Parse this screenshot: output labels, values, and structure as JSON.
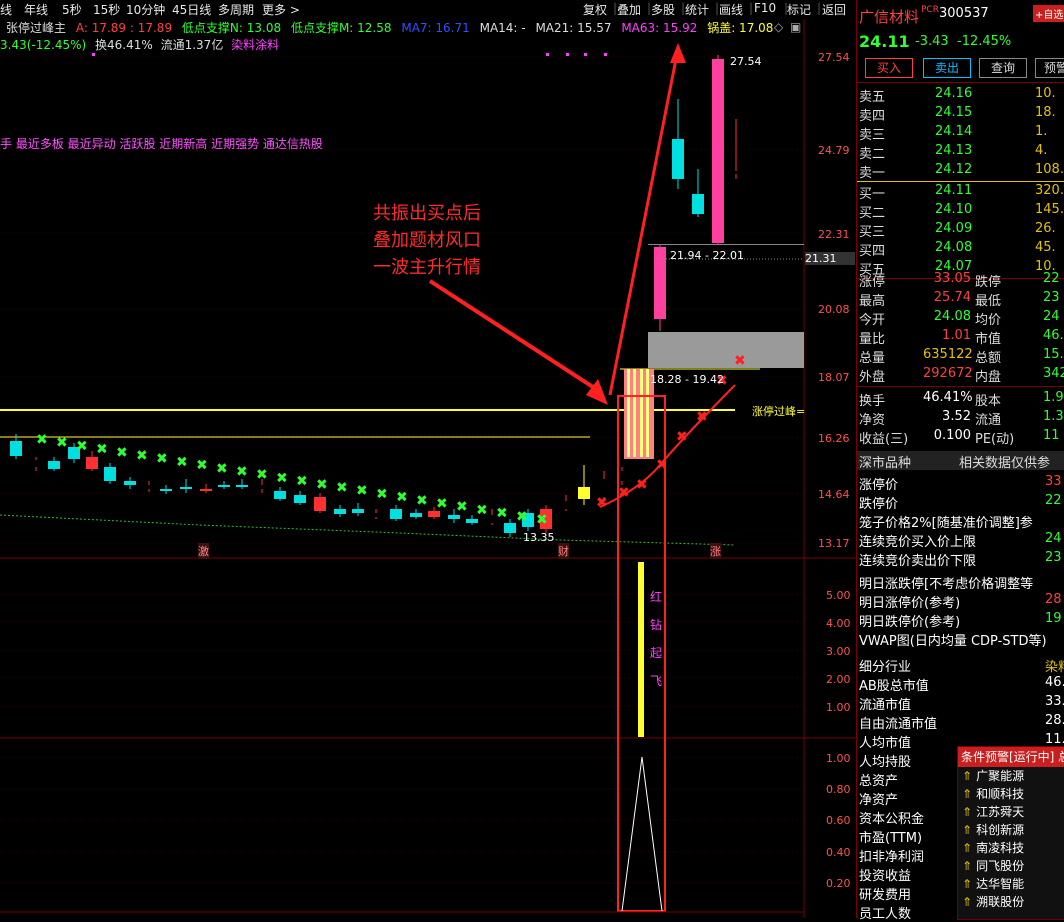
{
  "topbar": {
    "periods": [
      "线",
      "年线",
      "5秒",
      "15秒",
      "10分钟",
      "45日线",
      "多周期",
      "更多 >"
    ],
    "right_buttons": [
      "复权",
      "叠加",
      "多股",
      "统计",
      "画线",
      "F10",
      "标记",
      "返回"
    ]
  },
  "indicator": {
    "name": "张停过峰主",
    "a_label": "A: 17.89 : 17.89",
    "dizhi_n": "低点支撑N: 13.08",
    "dizhi_m": "低点支撑M: 12.58",
    "ma7": "MA7: 16.71",
    "ma14": "MA14: -",
    "ma21": "MA21: 15.57",
    "ma63": "MA63: 15.92",
    "guogai": "锅盖: 17.08",
    "change": "3.43(-12.45%)",
    "turnover": "换46.41%",
    "float": "流通1.37亿",
    "sector": "染料涂料"
  },
  "tags": "手 最近多板 最近异动 活跃股 近期新高 近期强势 通达信热股",
  "annotation": [
    "共振出买点后",
    "叠加题材风口",
    "一波主升行情"
  ],
  "chart_labels": {
    "high_price": "27.54",
    "low_price": "13.35",
    "zone1": "21.94 - 22.01",
    "zone2": "18.28 - 19.42",
    "limit_line": "涨停过峰=",
    "current_price_tag": "21.31",
    "marks": [
      "激",
      "财",
      "涨"
    ],
    "sub_marks": [
      "红",
      "钻",
      "起",
      "飞"
    ]
  },
  "price_axis": [
    "27.54",
    "24.79",
    "22.31",
    "20.08",
    "18.07",
    "16.26",
    "14.64",
    "13.17"
  ],
  "sub_axis1": [
    "5.00",
    "4.00",
    "3.00",
    "2.00",
    "1.00"
  ],
  "sub_axis2": [
    "1.00",
    "0.80",
    "0.60",
    "0.40",
    "0.20"
  ],
  "stock": {
    "name": "广信材料",
    "pcr": "PCR",
    "code": "300537",
    "add_btn": "+自选",
    "price": "24.11",
    "change": "-3.43",
    "pct": "-12.45%",
    "buttons": [
      "买入",
      "卖出",
      "查询",
      "预警"
    ]
  },
  "order_book": {
    "sell": [
      {
        "label": "卖五",
        "price": "24.16",
        "vol": "10."
      },
      {
        "label": "卖四",
        "price": "24.15",
        "vol": "18."
      },
      {
        "label": "卖三",
        "price": "24.14",
        "vol": "1."
      },
      {
        "label": "卖二",
        "price": "24.13",
        "vol": "4."
      },
      {
        "label": "卖一",
        "price": "24.12",
        "vol": "108."
      }
    ],
    "buy": [
      {
        "label": "买一",
        "price": "24.11",
        "vol": "320."
      },
      {
        "label": "买二",
        "price": "24.10",
        "vol": "145."
      },
      {
        "label": "买三",
        "price": "24.09",
        "vol": "26."
      },
      {
        "label": "买四",
        "price": "24.08",
        "vol": "45."
      },
      {
        "label": "买五",
        "price": "24.07",
        "vol": "10."
      }
    ]
  },
  "stats": [
    {
      "l1": "涨停",
      "v1": "33.05",
      "l2": "跌停",
      "v2": "22"
    },
    {
      "l1": "最高",
      "v1": "25.74",
      "l2": "最低",
      "v2": "23"
    },
    {
      "l1": "今开",
      "v1": "24.08",
      "l2": "均价",
      "v2": "24"
    },
    {
      "l1": "量比",
      "v1": "1.01",
      "l2": "市值",
      "v2": "46."
    },
    {
      "l1": "总量",
      "v1": "635122",
      "l2": "总额",
      "v2": "15."
    },
    {
      "l1": "外盘",
      "v1": "292672",
      "l2": "内盘",
      "v2": "342"
    }
  ],
  "stats2": [
    {
      "l1": "换手",
      "v1": "46.41%",
      "l2": "股本",
      "v2": "1.9"
    },
    {
      "l1": "净资",
      "v1": "3.52",
      "l2": "流通",
      "v2": "1.3"
    },
    {
      "l1": "收益(三)",
      "v1": "0.100",
      "l2": "PE(动)",
      "v2": "11"
    }
  ],
  "market": {
    "label": "深市品种",
    "link": "相关数据仅供参"
  },
  "limits": [
    {
      "l": "涨停价",
      "v": "33"
    },
    {
      "l": "跌停价",
      "v": "22"
    },
    {
      "l": "笼子价格2%[随基准价调整]参",
      "v": ""
    },
    {
      "l": "连续竞价买入价上限",
      "v": "24"
    },
    {
      "l": "连续竞价卖出价下限",
      "v": "23"
    }
  ],
  "tomorrow": [
    {
      "l": "明日涨跌停[不考虑价格调整等",
      "v": ""
    },
    {
      "l": "明日涨停价(参考)",
      "v": "28"
    },
    {
      "l": "明日跌停价(参考)",
      "v": "19"
    }
  ],
  "vwap": "VWAP图(日内均量 CDP-STD等)",
  "fundamentals": [
    {
      "l": "细分行业",
      "v": "染料涂"
    },
    {
      "l": "AB股总市值",
      "v": "46.5"
    },
    {
      "l": "流通市值",
      "v": "33.0"
    },
    {
      "l": "自由流通市值",
      "v": "28.0"
    },
    {
      "l": "人均市值",
      "v": "11.6"
    },
    {
      "l": "人均持股",
      "v": ""
    },
    {
      "l": "总资产",
      "v": ""
    },
    {
      "l": "净资产",
      "v": ""
    },
    {
      "l": "资本公积金",
      "v": ""
    },
    {
      "l": "市盈(TTM)",
      "v": ""
    },
    {
      "l": "扣非净利润",
      "v": ""
    },
    {
      "l": "投资收益",
      "v": ""
    },
    {
      "l": "研发费用",
      "v": ""
    },
    {
      "l": "员工人数",
      "v": ""
    }
  ],
  "popup": {
    "title": "条件预警[运行中] 总",
    "items": [
      "广聚能源",
      "和顺科技",
      "江苏舜天",
      "科创新源",
      "南凌科技",
      "同飞股份",
      "达华智能",
      "溯联股份"
    ]
  },
  "colors": {
    "up": "#ff3030",
    "down": "#00d0d0",
    "yellow": "#ffff30",
    "magenta": "#ff40ff",
    "green": "#30ff30"
  }
}
